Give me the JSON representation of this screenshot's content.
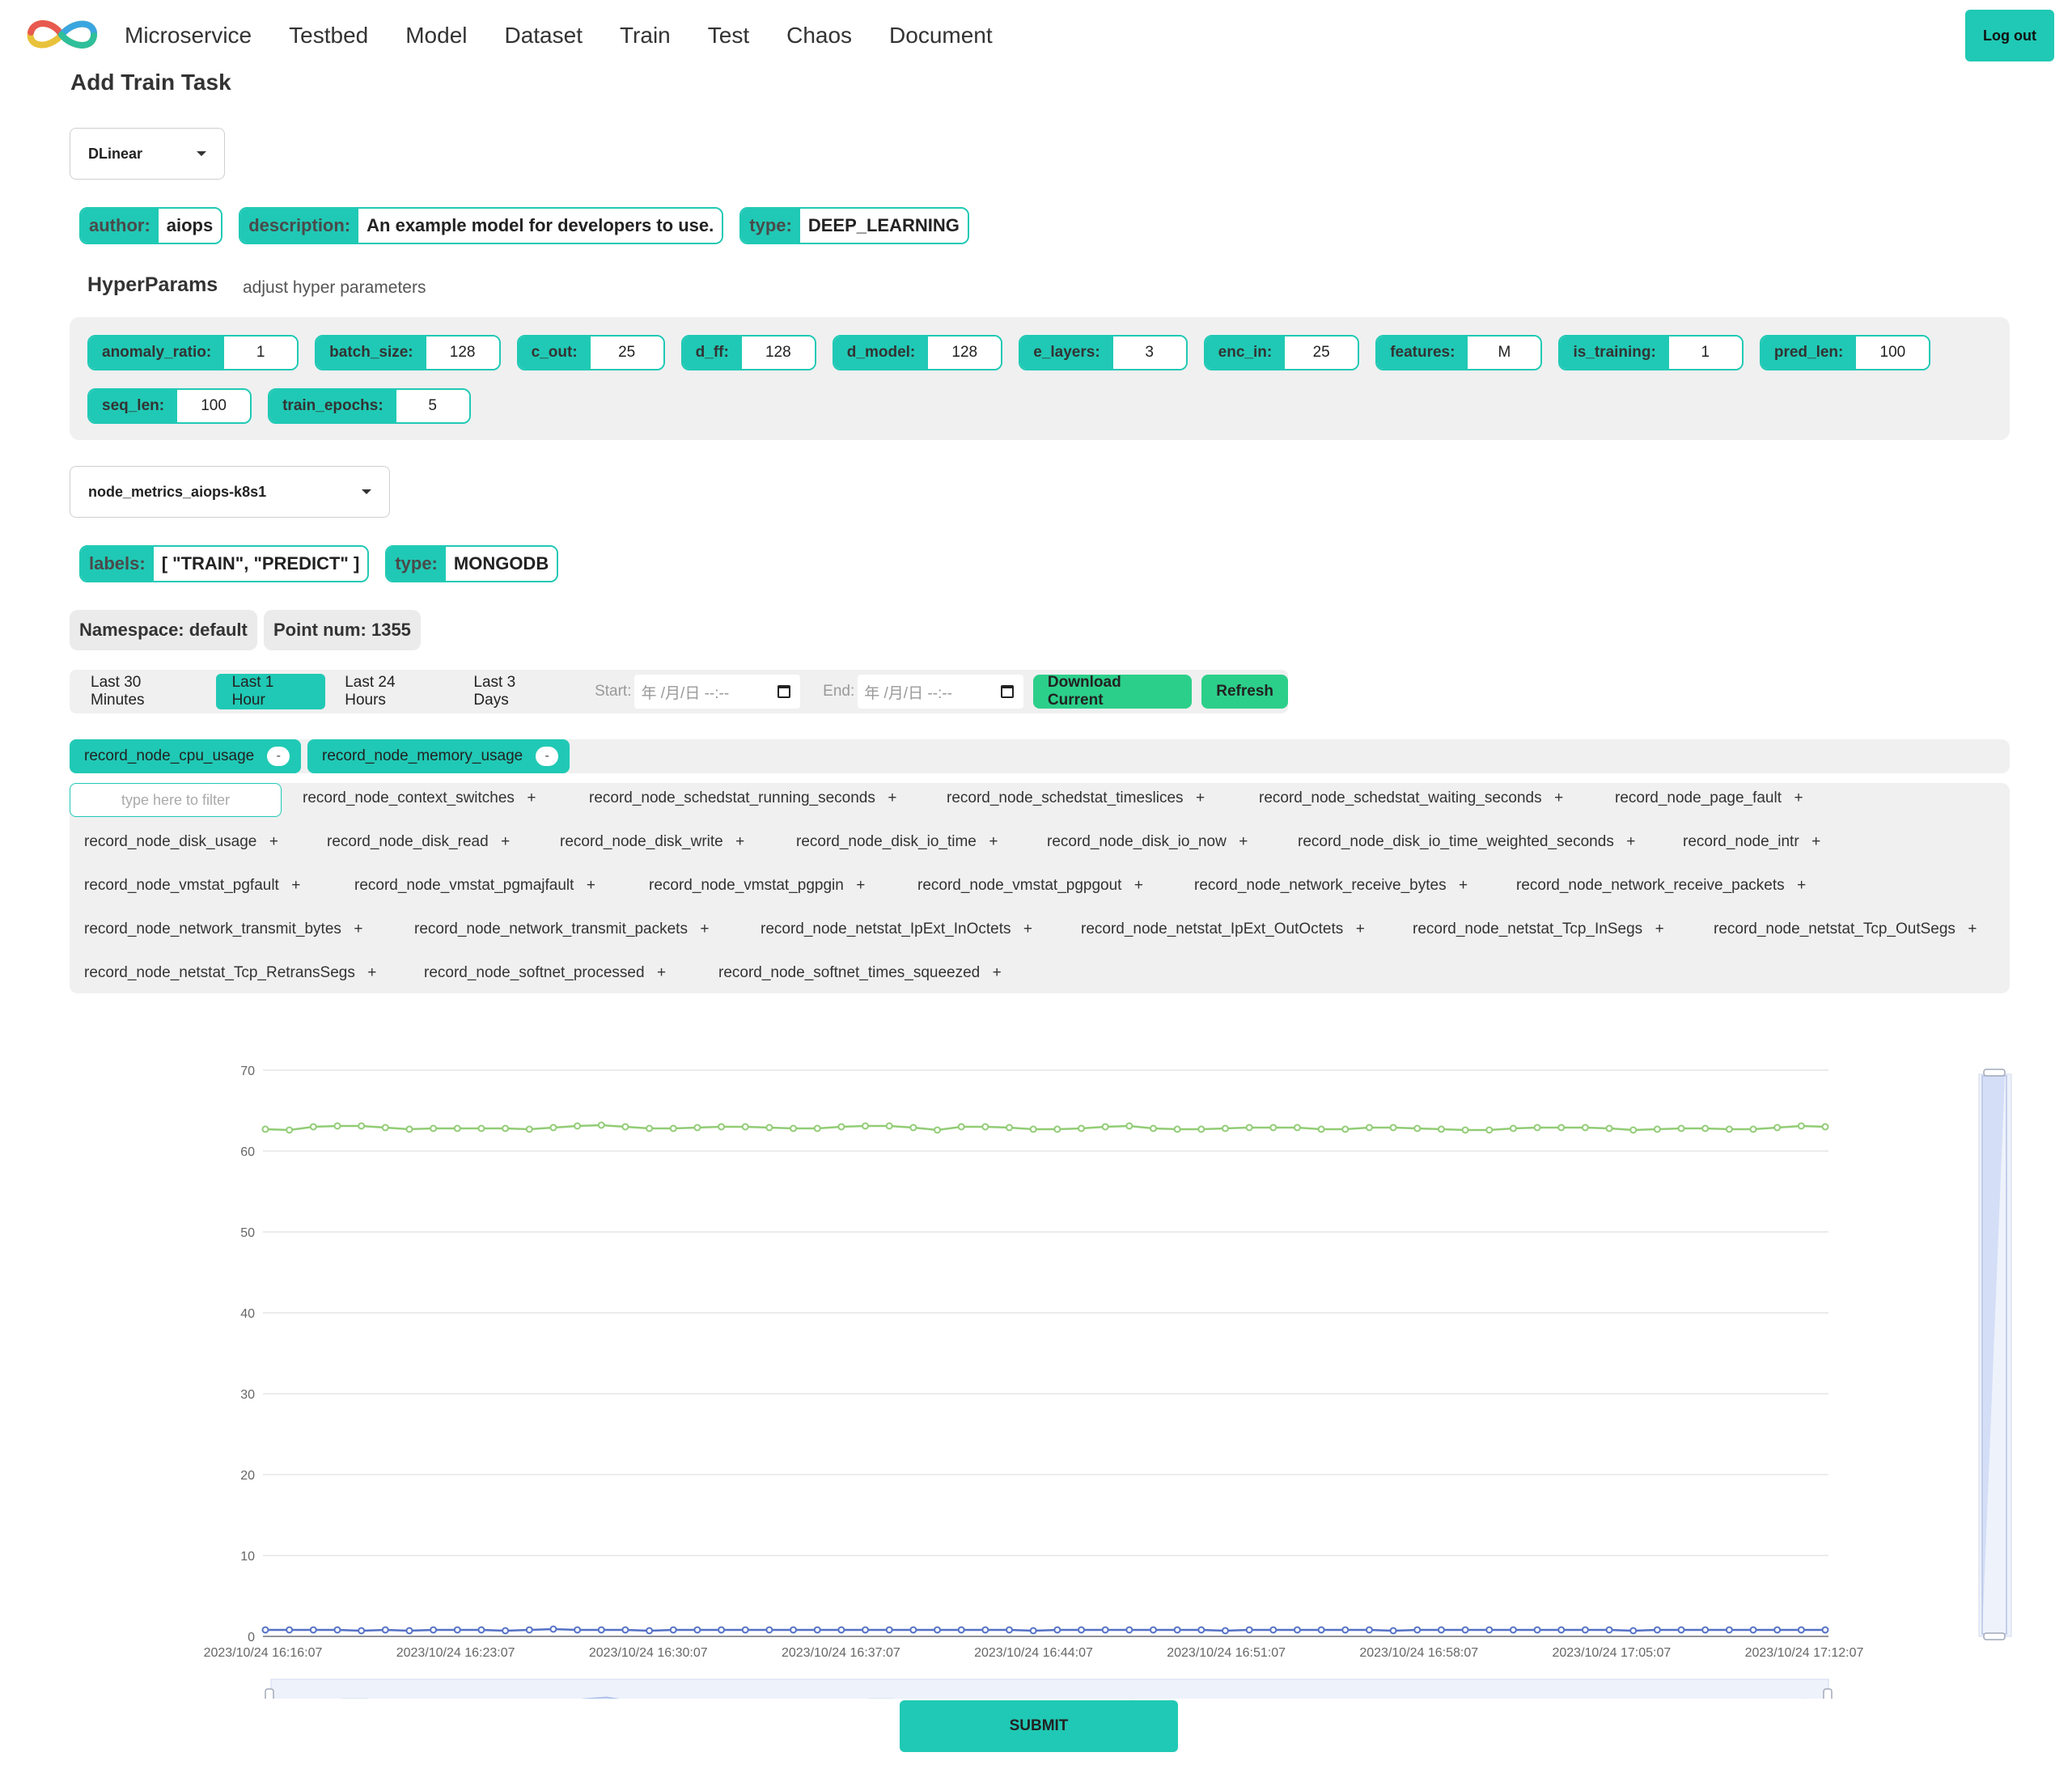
{
  "nav": {
    "items": [
      "Microservice",
      "Testbed",
      "Model",
      "Dataset",
      "Train",
      "Test",
      "Chaos",
      "Document"
    ],
    "logout_label": "Log out"
  },
  "page_title": "Add Train Task",
  "model_select": {
    "value": "DLinear"
  },
  "model_info": [
    {
      "key": "author:",
      "value": "aiops"
    },
    {
      "key": "description:",
      "value": "An example model for developers to use."
    },
    {
      "key": "type:",
      "value": "DEEP_LEARNING"
    }
  ],
  "hyperparams": {
    "title": "HyperParams",
    "subtitle": "adjust hyper parameters",
    "items": [
      {
        "key": "anomaly_ratio:",
        "value": "1"
      },
      {
        "key": "batch_size:",
        "value": "128"
      },
      {
        "key": "c_out:",
        "value": "25"
      },
      {
        "key": "d_ff:",
        "value": "128"
      },
      {
        "key": "d_model:",
        "value": "128"
      },
      {
        "key": "e_layers:",
        "value": "3"
      },
      {
        "key": "enc_in:",
        "value": "25"
      },
      {
        "key": "features:",
        "value": "M"
      },
      {
        "key": "is_training:",
        "value": "1"
      },
      {
        "key": "pred_len:",
        "value": "100"
      },
      {
        "key": "seq_len:",
        "value": "100"
      },
      {
        "key": "train_epochs:",
        "value": "5"
      }
    ]
  },
  "dataset_select": {
    "value": "node_metrics_aiops-k8s1"
  },
  "dataset_info": [
    {
      "key": "labels:",
      "value": "[ \"TRAIN\", \"PREDICT\" ]"
    },
    {
      "key": "type:",
      "value": "MONGODB"
    }
  ],
  "namespace_label": "Namespace: default",
  "point_num_label": "Point num: 1355",
  "time_range": {
    "buttons": [
      "Last 30 Minutes",
      "Last 1 Hour",
      "Last 24 Hours",
      "Last 3 Days"
    ],
    "active": "Last 1 Hour",
    "start_label": "Start:",
    "end_label": "End:",
    "date_placeholder": "年 /月/日 --:--",
    "download_label": "Download Current",
    "refresh_label": "Refresh"
  },
  "selected_metrics": [
    {
      "label": "record_node_cpu_usage",
      "remove": "-"
    },
    {
      "label": "record_node_memory_usage",
      "remove": "-"
    }
  ],
  "filter_placeholder": "type here to filter",
  "add_symbol": "+",
  "available_metrics": [
    "record_node_context_switches",
    "record_node_schedstat_running_seconds",
    "record_node_schedstat_timeslices",
    "record_node_schedstat_waiting_seconds",
    "record_node_page_fault",
    "record_node_disk_usage",
    "record_node_disk_read",
    "record_node_disk_write",
    "record_node_disk_io_time",
    "record_node_disk_io_now",
    "record_node_disk_io_time_weighted_seconds",
    "record_node_intr",
    "record_node_vmstat_pgfault",
    "record_node_vmstat_pgmajfault",
    "record_node_vmstat_pgpgin",
    "record_node_vmstat_pgpgout",
    "record_node_network_receive_bytes",
    "record_node_network_receive_packets",
    "record_node_network_transmit_bytes",
    "record_node_network_transmit_packets",
    "record_node_netstat_IpExt_InOctets",
    "record_node_netstat_IpExt_OutOctets",
    "record_node_netstat_Tcp_InSegs",
    "record_node_netstat_Tcp_OutSegs",
    "record_node_netstat_Tcp_RetransSegs",
    "record_node_softnet_processed",
    "record_node_softnet_times_squeezed"
  ],
  "chart_data": {
    "type": "line",
    "ylim": [
      0,
      70
    ],
    "yticks": [
      0,
      10,
      20,
      30,
      40,
      50,
      60,
      70
    ],
    "xtick_labels": [
      "2023/10/24 16:16:07",
      "2023/10/24 16:23:07",
      "2023/10/24 16:30:07",
      "2023/10/24 16:37:07",
      "2023/10/24 16:44:07",
      "2023/10/24 16:51:07",
      "2023/10/24 16:58:07",
      "2023/10/24 17:05:07",
      "2023/10/24 17:12:07"
    ],
    "grid": true,
    "series": [
      {
        "color": "#91cc75",
        "values": [
          62.7,
          62.6,
          63.0,
          63.1,
          63.1,
          62.9,
          62.7,
          62.8,
          62.8,
          62.8,
          62.8,
          62.7,
          62.9,
          63.1,
          63.2,
          63.0,
          62.8,
          62.8,
          62.9,
          63.0,
          63.0,
          62.9,
          62.8,
          62.8,
          63.0,
          63.1,
          63.1,
          62.9,
          62.6,
          63.0,
          63.0,
          62.9,
          62.7,
          62.7,
          62.8,
          63.0,
          63.1,
          62.8,
          62.7,
          62.7,
          62.8,
          62.9,
          62.9,
          62.9,
          62.7,
          62.7,
          62.9,
          62.9,
          62.8,
          62.7,
          62.6,
          62.6,
          62.8,
          62.9,
          62.9,
          62.9,
          62.8,
          62.6,
          62.7,
          62.8,
          62.8,
          62.7,
          62.7,
          62.9,
          63.1,
          63.0
        ]
      },
      {
        "color": "#5470c6",
        "values": [
          0.8,
          0.8,
          0.8,
          0.8,
          0.7,
          0.8,
          0.7,
          0.8,
          0.8,
          0.8,
          0.7,
          0.8,
          0.9,
          0.8,
          0.8,
          0.8,
          0.7,
          0.8,
          0.8,
          0.8,
          0.8,
          0.8,
          0.8,
          0.8,
          0.8,
          0.8,
          0.8,
          0.8,
          0.8,
          0.8,
          0.8,
          0.8,
          0.7,
          0.8,
          0.8,
          0.8,
          0.8,
          0.8,
          0.8,
          0.8,
          0.7,
          0.8,
          0.8,
          0.8,
          0.8,
          0.8,
          0.8,
          0.7,
          0.8,
          0.8,
          0.8,
          0.8,
          0.8,
          0.8,
          0.8,
          0.8,
          0.8,
          0.7,
          0.8,
          0.8,
          0.8,
          0.8,
          0.8,
          0.8,
          0.8,
          0.8
        ]
      }
    ]
  },
  "submit_label": "SUBMIT"
}
